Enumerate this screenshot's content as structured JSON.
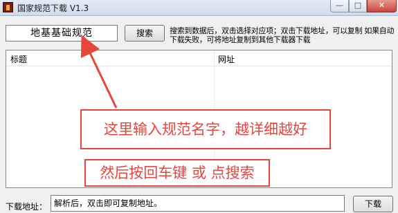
{
  "window": {
    "title": "国家规范下载 V1.3",
    "min_glyph": "—",
    "max_glyph": "□",
    "close_glyph": "✕"
  },
  "search": {
    "value": "地基基础规范",
    "button_label": "搜索"
  },
  "hint": "搜索到数据后，双击选择对应项；双击下载地址，可以复制 如果自动下载失败，可将地址复制到其他下载器下载",
  "list": {
    "columns": [
      "标题",
      "网址"
    ]
  },
  "annotations": {
    "callout_1": "这里输入规范名字，越详细越好",
    "callout_2": "然后按回车键 或 点搜索",
    "color": "#e8453c"
  },
  "download": {
    "label": "下载地址：",
    "value": "解析后，双击即可复制地址。",
    "button_label": "下载"
  }
}
